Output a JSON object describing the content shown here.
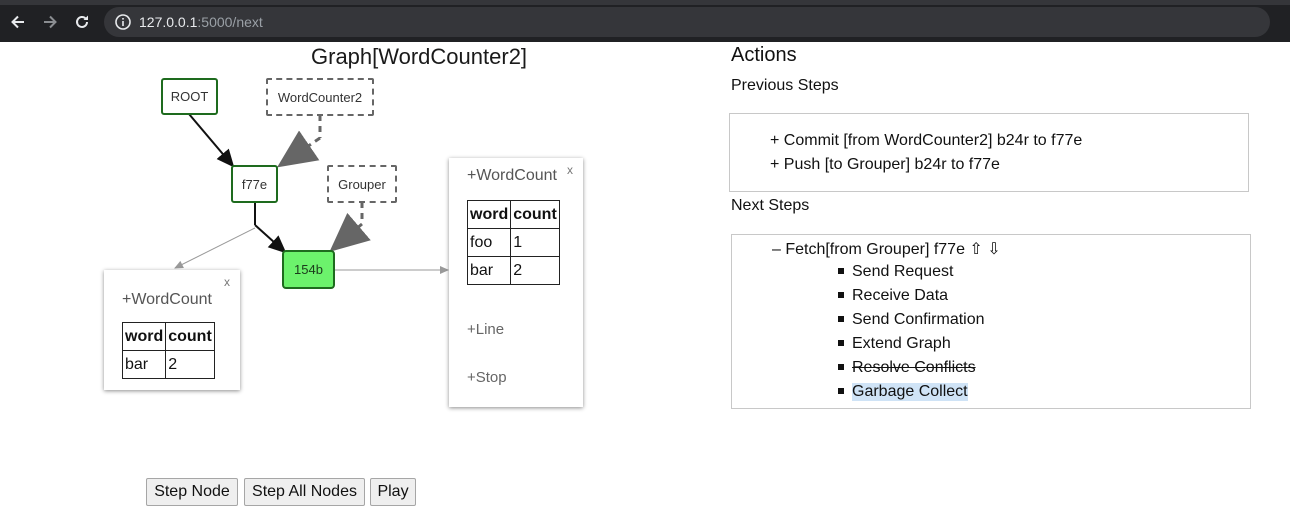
{
  "browser": {
    "url_host": "127.0.0.1",
    "url_rest": ":5000/next"
  },
  "graph": {
    "title": "Graph[WordCounter2]",
    "nodes": {
      "root": "ROOT",
      "wordcounter2": "WordCounter2",
      "f77e": "f77e",
      "grouper": "Grouper",
      "n154b": "154b"
    },
    "popup_left": {
      "head": "+WordCount",
      "close": "x",
      "columns": [
        "word",
        "count"
      ],
      "rows": [
        [
          "bar",
          "2"
        ]
      ]
    },
    "popup_right": {
      "head": "+WordCount",
      "close": "x",
      "columns": [
        "word",
        "count"
      ],
      "rows": [
        [
          "foo",
          "1"
        ],
        [
          "bar",
          "2"
        ]
      ],
      "line_label": "+Line",
      "stop_label": "+Stop"
    }
  },
  "controls": {
    "step_node": "Step Node",
    "step_all": "Step All Nodes",
    "play": "Play"
  },
  "actions": {
    "title": "Actions",
    "previous_title": "Previous Steps",
    "previous": [
      "+ Commit [from WordCounter2] b24r to f77e",
      "+ Push [to Grouper] b24r to f77e"
    ],
    "next_title": "Next Steps",
    "next_header": "– Fetch[from Grouper] f77e ⇧ ⇩",
    "next_items": [
      {
        "label": "Send Request",
        "state": "normal"
      },
      {
        "label": "Receive Data",
        "state": "normal"
      },
      {
        "label": "Send Confirmation",
        "state": "normal"
      },
      {
        "label": "Extend Graph",
        "state": "normal"
      },
      {
        "label": "Resolve Conflicts",
        "state": "struck"
      },
      {
        "label": "Garbage Collect",
        "state": "highlighted"
      }
    ]
  },
  "colors": {
    "active_node": "#6cf26c",
    "node_border": "#1e6b1e",
    "highlight": "#cfe3f6"
  }
}
